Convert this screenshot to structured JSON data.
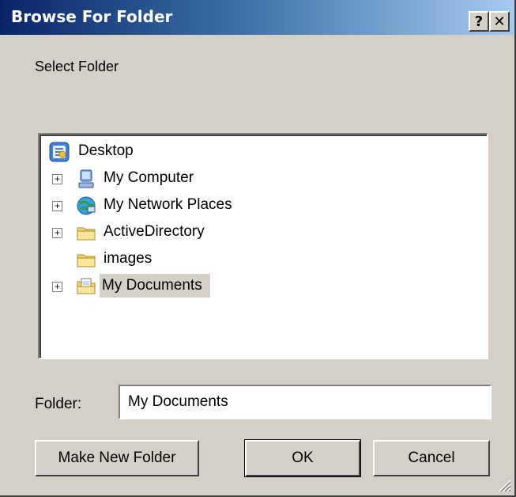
{
  "window": {
    "title": "Browse For Folder",
    "help_label": "?",
    "close_label": "✕"
  },
  "instruction": "Select Folder",
  "tree": {
    "root": {
      "label": "Desktop",
      "icon": "desktop-icon"
    },
    "items": [
      {
        "label": "My Computer",
        "icon": "computer-icon",
        "expandable": true
      },
      {
        "label": "My Network Places",
        "icon": "network-icon",
        "expandable": true
      },
      {
        "label": "ActiveDirectory",
        "icon": "folder-icon",
        "expandable": true
      },
      {
        "label": "images",
        "icon": "folder-icon",
        "expandable": false
      },
      {
        "label": "My Documents",
        "icon": "documents-folder-icon",
        "expandable": true,
        "selected": true
      }
    ],
    "expander_glyph": "+"
  },
  "folder": {
    "label": "Folder:",
    "value": "My Documents"
  },
  "buttons": {
    "make_new_folder": "Make New Folder",
    "ok": "OK",
    "cancel": "Cancel"
  },
  "colors": {
    "face": "#d4d0c8",
    "title_start": "#0a246a",
    "title_end": "#a6caf0"
  }
}
